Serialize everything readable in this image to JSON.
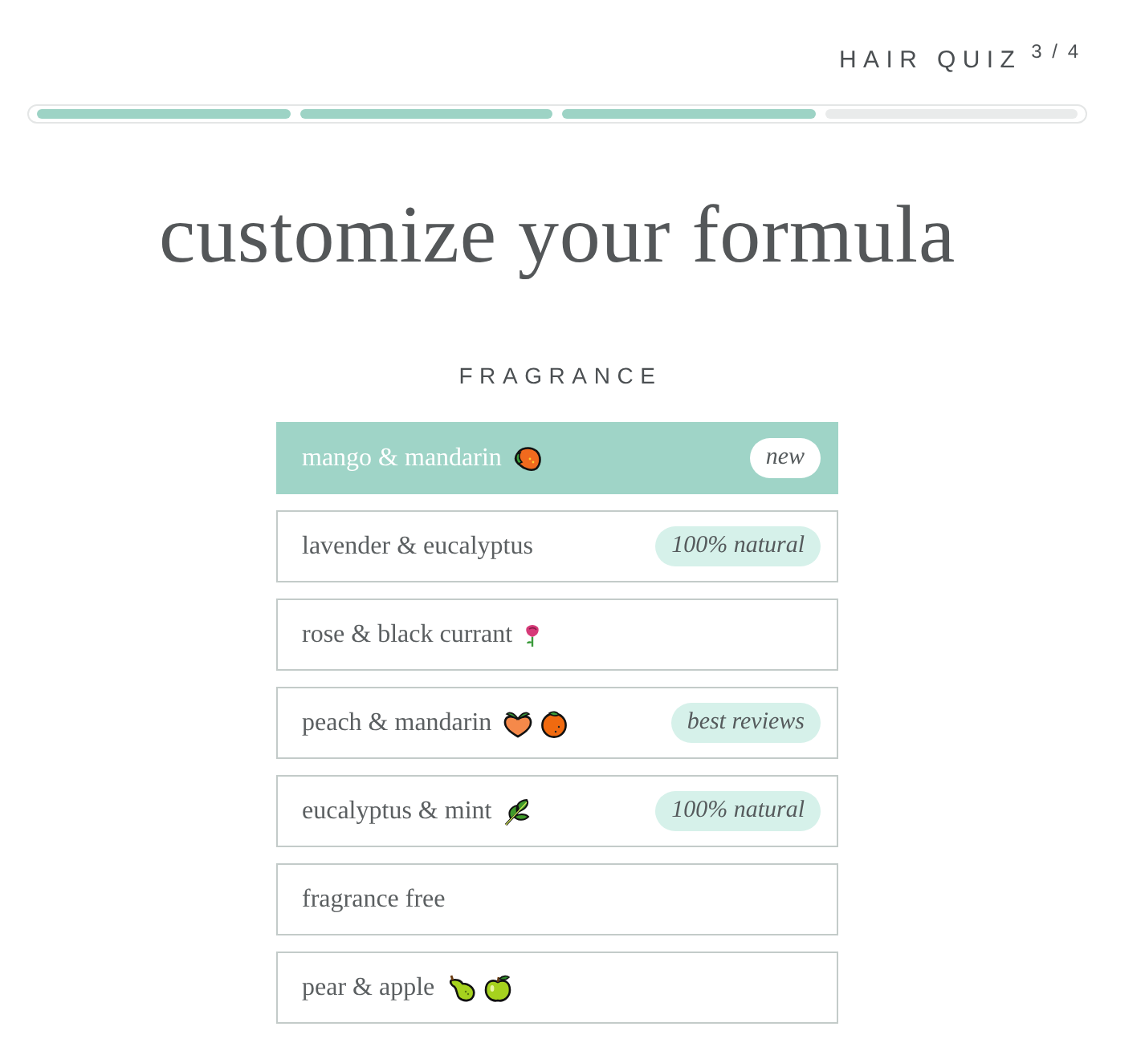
{
  "header": {
    "title": "HAIR QUIZ",
    "step": "3 / 4"
  },
  "progress": {
    "segments": [
      {
        "filled": true
      },
      {
        "filled": true
      },
      {
        "filled": true
      },
      {
        "filled": false
      }
    ]
  },
  "heading": "customize your formula",
  "section": {
    "label": "FRAGRANCE",
    "options": [
      {
        "label": "mango & mandarin",
        "icons": [
          {
            "kind": "mango"
          }
        ],
        "badge": "new",
        "selected": true
      },
      {
        "label": "lavender & eucalyptus",
        "badge": "100% natural",
        "selected": false
      },
      {
        "label": "rose & black currant",
        "icons": [
          {
            "kind": "rose"
          }
        ],
        "selected": false
      },
      {
        "label": "peach & mandarin",
        "icons": [
          {
            "kind": "peach"
          },
          {
            "kind": "tangerine"
          }
        ],
        "badge": "best reviews",
        "selected": false
      },
      {
        "label": "eucalyptus & mint",
        "icons": [
          {
            "kind": "leaf"
          }
        ],
        "badge": "100% natural",
        "selected": false
      },
      {
        "label": "fragrance free",
        "selected": false
      },
      {
        "label": "pear & apple",
        "icons": [
          {
            "kind": "pear"
          },
          {
            "kind": "apple"
          }
        ],
        "selected": false
      }
    ]
  }
}
